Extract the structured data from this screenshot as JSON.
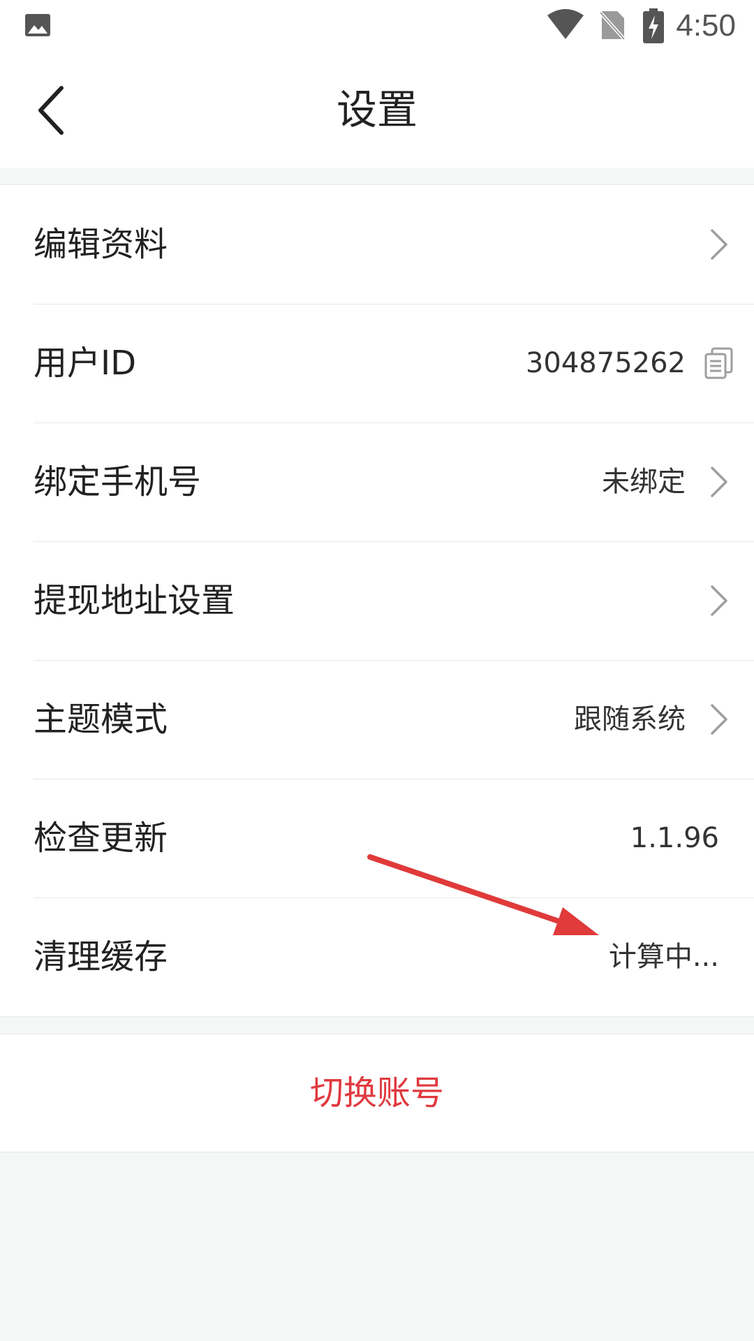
{
  "status_bar": {
    "time": "4:50",
    "icons": [
      "gallery-icon",
      "wifi-icon",
      "no-sim-icon",
      "battery-charging-icon"
    ]
  },
  "header": {
    "title": "设置",
    "back_icon": "chevron-left-icon"
  },
  "settings": {
    "edit_profile": {
      "label": "编辑资料"
    },
    "user_id": {
      "label": "用户ID",
      "value": "304875262",
      "action_icon": "copy-icon"
    },
    "bind_phone": {
      "label": "绑定手机号",
      "value": "未绑定"
    },
    "withdraw_address": {
      "label": "提现地址设置"
    },
    "theme_mode": {
      "label": "主题模式",
      "value": "跟随系统"
    },
    "check_update": {
      "label": "检查更新",
      "value": "1.1.96"
    },
    "clear_cache": {
      "label": "清理缓存",
      "value": "计算中..."
    }
  },
  "switch_account": {
    "label": "切换账号"
  },
  "colors": {
    "accent_red": "#e0393e",
    "annotation_arrow": "#e03a3a",
    "page_background": "#f5f6f6",
    "card_background": "#ffffff"
  }
}
